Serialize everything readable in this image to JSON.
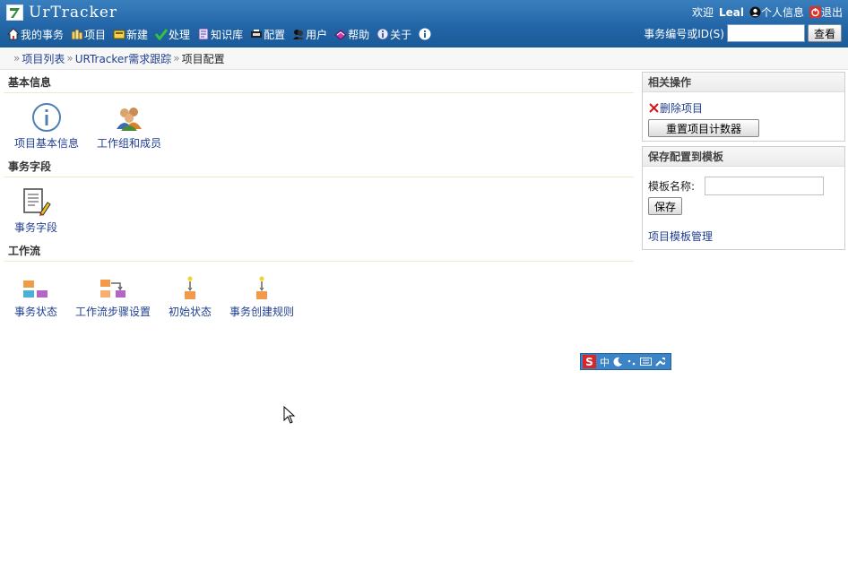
{
  "app": {
    "logo_text": "UrTracker"
  },
  "nav": {
    "items": [
      {
        "label": "我的事务",
        "icon": "home-icon"
      },
      {
        "label": "项目",
        "icon": "project-icon"
      },
      {
        "label": "新建",
        "icon": "new-icon"
      },
      {
        "label": "处理",
        "icon": "check-icon"
      },
      {
        "label": "知识库",
        "icon": "knowledge-icon"
      },
      {
        "label": "配置",
        "icon": "config-icon"
      },
      {
        "label": "用户",
        "icon": "users-icon"
      },
      {
        "label": "帮助",
        "icon": "help-book-icon"
      },
      {
        "label": "关于",
        "icon": "about-icon"
      }
    ]
  },
  "user_bar": {
    "welcome": "欢迎",
    "username": "Leal",
    "profile": "个人信息",
    "logout": "退出"
  },
  "search": {
    "label": "事务编号或ID(S)",
    "value": "",
    "button": "查看"
  },
  "breadcrumb": {
    "items": [
      "项目列表",
      "URTracker需求跟踪"
    ],
    "current": "项目配置"
  },
  "sections": {
    "basic": {
      "title": "基本信息",
      "tiles": [
        "项目基本信息",
        "工作组和成员"
      ]
    },
    "fields": {
      "title": "事务字段",
      "tiles": [
        "事务字段"
      ]
    },
    "workflow": {
      "title": "工作流",
      "tiles": [
        "事务状态",
        "工作流步骤设置",
        "初始状态",
        "事务创建规则"
      ]
    }
  },
  "related": {
    "title": "相关操作",
    "delete_link": "删除项目",
    "reset_button": "重置项目计数器"
  },
  "template": {
    "title": "保存配置到模板",
    "name_label": "模板名称:",
    "name_value": "",
    "save_button": "保存",
    "manage_link": "项目模板管理"
  },
  "ime": {
    "logo": "S",
    "mode": "中"
  },
  "colors": {
    "header": "#2164a6",
    "link": "#1f3f8f",
    "ime": "#3b84c7"
  }
}
